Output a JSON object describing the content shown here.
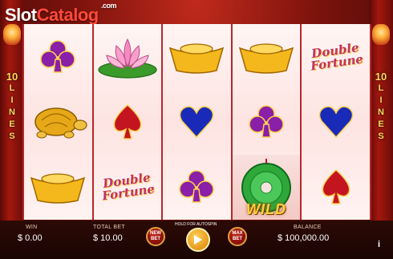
{
  "brand": {
    "part1": "Slot",
    "part2": "Catalog",
    "suffix": ".com"
  },
  "paylines": {
    "count": "10",
    "word": "LINES"
  },
  "symbols": {
    "double_fortune_line1": "Double",
    "double_fortune_line2": "Fortune",
    "wild": "WILD"
  },
  "reels": [
    [
      "club-symbol",
      "turtle-symbol",
      "gold-ingot-symbol"
    ],
    [
      "lotus-symbol",
      "spade-symbol",
      "double-fortune-symbol"
    ],
    [
      "gold-ingot-symbol",
      "heart-symbol",
      "club-symbol"
    ],
    [
      "gold-ingot-symbol",
      "club-symbol",
      "wild-symbol"
    ],
    [
      "double-fortune-symbol",
      "heart-symbol",
      "spade-symbol"
    ]
  ],
  "footer": {
    "win_label": "WIN",
    "win_value": "$ 0.00",
    "total_bet_label": "TOTAL BET",
    "total_bet_value": "$ 10.00",
    "new_bet_l1": "NEW",
    "new_bet_l2": "BET",
    "hold_text": "HOLD FOR AUTOSPIN",
    "max_bet_l1": "MAX",
    "max_bet_l2": "BET",
    "balance_label": "BALANCE",
    "balance_value": "$ 100,000.00",
    "info": "i"
  },
  "colors": {
    "club": "#8a1fa8",
    "spade": "#c41420",
    "heart": "#1a2ab8",
    "gold": "#f4b81c",
    "reel_frame": "#b8262a"
  }
}
